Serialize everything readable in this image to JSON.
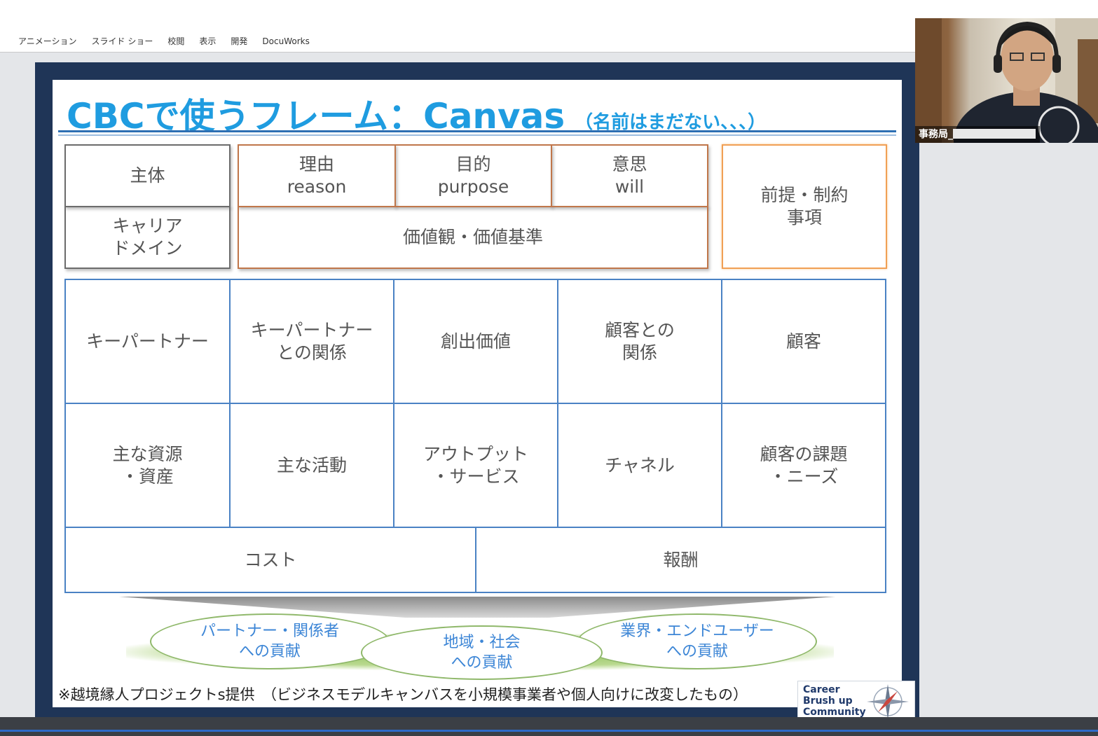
{
  "ribbon": {
    "tabs": [
      "アニメーション",
      "スライド ショー",
      "校閲",
      "表示",
      "開発",
      "DocuWorks"
    ]
  },
  "slide": {
    "title": "CBCで使うフレーム：Canvas",
    "subtitle": "（名前はまだない、、、）",
    "top_section": {
      "subject": "主体",
      "career_domain": "キャリア\nドメイン",
      "reason": "理由\nreason",
      "purpose": "目的\npurpose",
      "will": "意思\nwill",
      "values": "価値観・価値基準",
      "premise": "前提・制約\n事項"
    },
    "grid": {
      "row1": [
        "キーパートナー",
        "キーパートナー\nとの関係",
        "創出価値",
        "顧客との\n関係",
        "顧客"
      ],
      "row2": [
        "主な資源\n・資産",
        "主な活動",
        "アウトプット\n・サービス",
        "チャネル",
        "顧客の課題\n・ニーズ"
      ],
      "cost": "コスト",
      "reward": "報酬"
    },
    "contributions": {
      "partner": "パートナー・関係者\nへの貢献",
      "region": "地域・社会\nへの貢献",
      "industry": "業界・エンドユーザー\nへの貢献"
    },
    "footer_note": "※越境縁人プロジェクトs提供　（ビジネスモデルキャンバスを小規模事業者や個人向けに改変したもの）",
    "logo_text": "Career\nBrush up\nCommunity"
  },
  "webcam": {
    "name": "事務局_"
  },
  "colors": {
    "title_blue": "#1f9ce0",
    "frame_navy": "#1f3557",
    "cell_blue": "#4a82c4",
    "cell_brown": "#c0764a",
    "cell_orange": "#f1a055"
  }
}
